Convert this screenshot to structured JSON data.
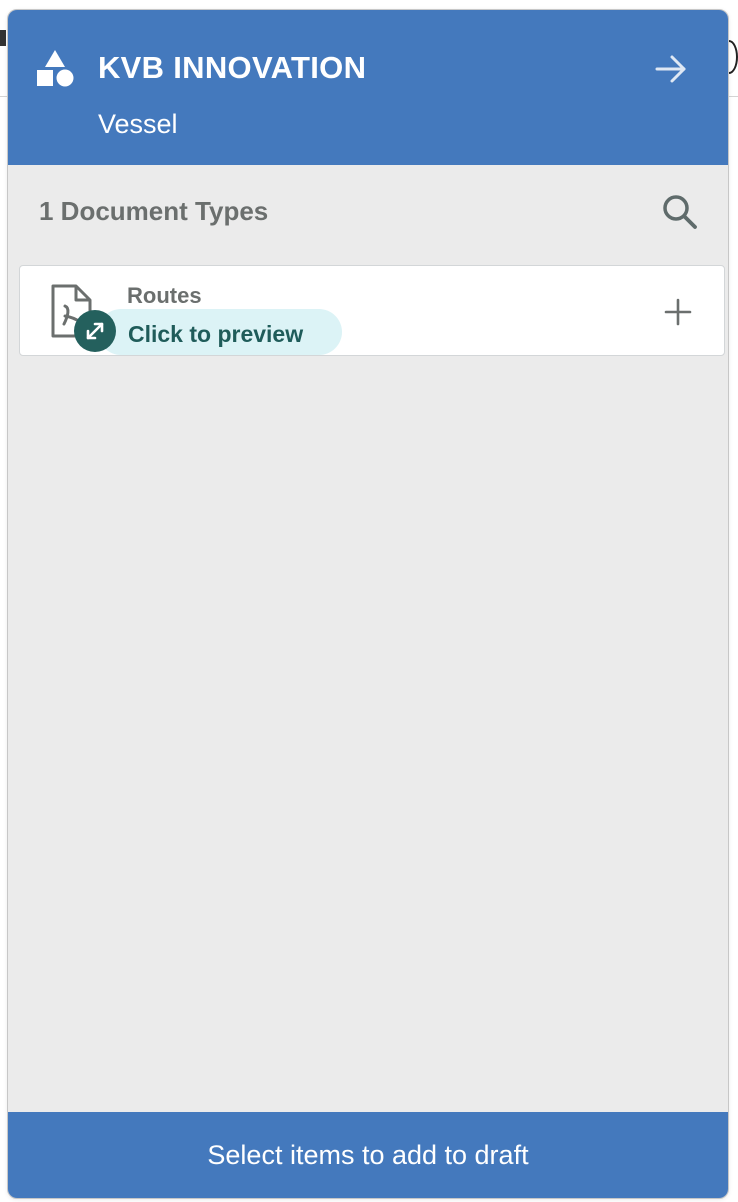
{
  "header": {
    "title": "KVB INNOVATION",
    "subtitle": "Vessel",
    "logo_icon": "shapes-icon",
    "action_icon": "arrow-right-icon"
  },
  "section": {
    "title": "1 Document Types",
    "search_icon": "search-icon"
  },
  "documents": [
    {
      "name": "Routes",
      "file_icon": "pdf-file-icon",
      "preview_label": "Click to preview",
      "preview_icon": "expand-icon",
      "add_icon": "plus-icon"
    }
  ],
  "footer": {
    "label": "Select items to add to draft"
  },
  "colors": {
    "brand_blue": "#4479bd",
    "panel_bg": "#ebebeb",
    "preview_bg": "#dcf3f6",
    "preview_text": "#1f5c5a",
    "badge": "#24605d",
    "muted_text": "#6b6f6e"
  }
}
